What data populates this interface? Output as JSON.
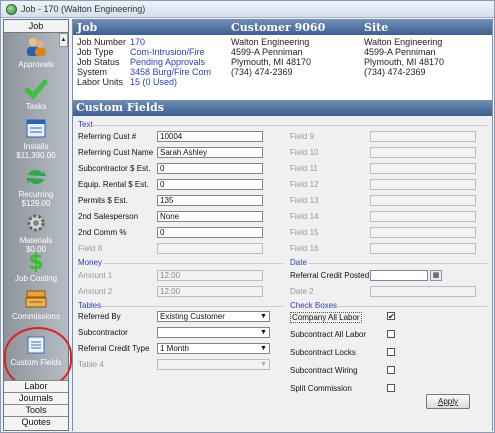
{
  "window": {
    "title": "Job - 170 (Walton Engineering)"
  },
  "sidebar": {
    "header": "Job",
    "items": [
      {
        "label": "Approvals",
        "icon": "approvals-people-icon"
      },
      {
        "label": "Tasks",
        "icon": "checkmark-icon"
      },
      {
        "label": "Installs",
        "sub": "$11,390.00",
        "icon": "installs-list-icon"
      },
      {
        "label": "Recurring",
        "sub": "$129.00",
        "icon": "recurring-arrows-icon"
      },
      {
        "label": "Materials",
        "sub": "$0.00",
        "icon": "gear-icon"
      },
      {
        "label": "Job Costing",
        "icon": "dollar-icon"
      },
      {
        "label": "Commissions",
        "icon": "cash-register-icon"
      },
      {
        "label": "Custom Fields",
        "icon": "custom-fields-icon"
      }
    ],
    "bottom_tabs": [
      "Labor",
      "Journals",
      "Tools",
      "Quotes"
    ]
  },
  "header": {
    "col1": "Job",
    "col2": "Customer 9060",
    "col3": "Site"
  },
  "job": {
    "labels": [
      "Job Number",
      "Job Type",
      "Job Status",
      "System",
      "Labor Units"
    ],
    "values": [
      "170",
      "Com-Intrusion/Fire",
      "Pending Approvals",
      "3458 Burg/Fire Com",
      "15 (0 Used)"
    ]
  },
  "customer": {
    "lines": [
      "Walton Engineering",
      "4599-A Penniman",
      "Plymouth, MI 48170",
      "(734) 474-2369"
    ]
  },
  "site": {
    "lines": [
      "Walton Engineering",
      "4599-A Penniman",
      "Plymouth, MI 48170",
      "(734) 474-2369"
    ]
  },
  "custom_fields": {
    "title": "Custom Fields",
    "text_section": "Text",
    "text_left": [
      {
        "label": "Referring Cust #",
        "value": "10004"
      },
      {
        "label": "Referring Cust Name",
        "value": "Sarah Ashley"
      },
      {
        "label": "Subcontractor $ Est.",
        "value": "0"
      },
      {
        "label": "Equip. Rental $ Est.",
        "value": "0"
      },
      {
        "label": "Permits $ Est.",
        "value": "135"
      },
      {
        "label": "2nd Salesperson",
        "value": "None"
      },
      {
        "label": "2nd Comm %",
        "value": "0"
      },
      {
        "label": "Field 8",
        "value": ""
      }
    ],
    "text_right": [
      "Field 9",
      "Field 10",
      "Field 11",
      "Field 12",
      "Field 13",
      "Field 14",
      "Field 15",
      "Field 16"
    ],
    "money_section": "Money",
    "money": [
      {
        "label": "Amount 1",
        "value": "12.00"
      },
      {
        "label": "Amount 2",
        "value": "12.00"
      }
    ],
    "date_section": "Date",
    "dates": [
      {
        "label": "Referral Credit Posted",
        "value": ""
      },
      {
        "label": "Date 2",
        "value": ""
      }
    ],
    "tables_section": "Tables",
    "tables": [
      {
        "label": "Referred By",
        "value": "Existing Customer"
      },
      {
        "label": "Subcontractor",
        "value": ""
      },
      {
        "label": "Referral Credit Type",
        "value": "1 Month"
      },
      {
        "label": "Table 4",
        "value": ""
      }
    ],
    "checkbox_section": "Check Boxes",
    "checkboxes": [
      {
        "label": "Company All Labor",
        "checked": "✔"
      },
      {
        "label": "Subcontract All Labor",
        "checked": ""
      },
      {
        "label": "Subcontract Locks",
        "checked": ""
      },
      {
        "label": "Subcontract Wiring",
        "checked": ""
      },
      {
        "label": "Split Commission",
        "checked": ""
      }
    ],
    "apply_label": "Apply"
  }
}
